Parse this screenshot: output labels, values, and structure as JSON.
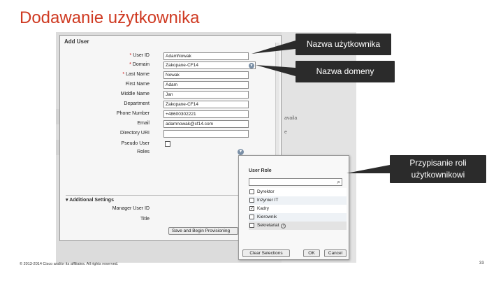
{
  "slide": {
    "title": "Dodawanie użytkownika",
    "footer": "© 2013-2014 Cisco and/or its affiliates. All rights reserved.",
    "page_number": "33"
  },
  "background": {
    "text_1": "availa",
    "text_2": "e"
  },
  "dialog": {
    "title": "Add User",
    "fields": [
      {
        "label": "User ID",
        "value": "AdamNowak",
        "required": true
      },
      {
        "label": "Domain",
        "value": "Zakopane-CF14",
        "required": true
      },
      {
        "label": "Last Name",
        "value": "Nowak",
        "required": true
      },
      {
        "label": "First Name",
        "value": "Adam",
        "required": false
      },
      {
        "label": "Middle Name",
        "value": "Jan",
        "required": false
      },
      {
        "label": "Department",
        "value": "Zakopane-CF14",
        "required": false
      },
      {
        "label": "Phone Number",
        "value": "+48600302221",
        "required": false
      },
      {
        "label": "Email",
        "value": "adamnowak@cf14.com",
        "required": false
      },
      {
        "label": "Directory URI",
        "value": "",
        "required": false
      },
      {
        "label": "Pseudo User",
        "value": "",
        "required": false
      },
      {
        "label": "Roles",
        "value": "",
        "required": false
      }
    ],
    "required_marker": "*",
    "additional_settings": "Additional Settings",
    "manager_user_id_label": "Manager User ID",
    "title_label": "Title",
    "save_button": "Save and Begin Provisioning"
  },
  "role_popup": {
    "title": "User Role",
    "search_placeholder": "",
    "roles": [
      {
        "name": "Dyrektor",
        "checked": false
      },
      {
        "name": "Inżynier IT",
        "checked": false
      },
      {
        "name": "Kadry",
        "checked": true
      },
      {
        "name": "Kierownik",
        "checked": false
      },
      {
        "name": "Sekretariat",
        "checked": false,
        "info": true
      }
    ],
    "clear_button": "Clear Selections",
    "ok_button": "OK",
    "cancel_button": "Cancel"
  },
  "callouts": {
    "user_name": "Nazwa użytkownika",
    "domain_name": "Nazwa domeny",
    "role_line1": "Przypisanie roli",
    "role_line2": "użytkownikowi"
  },
  "colors": {
    "title_red": "#cf3a22",
    "callout_bg": "#2b2b2b",
    "required_red": "#cc0000"
  }
}
